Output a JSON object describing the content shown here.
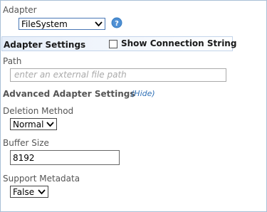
{
  "adapter": {
    "label": "Adapter",
    "selected": "FileSystem",
    "help_icon": "question-circle-icon"
  },
  "adapter_settings": {
    "title": "Adapter Settings",
    "show_connection_string_label": "Show Connection String",
    "show_connection_string_checked": false
  },
  "path": {
    "label": "Path",
    "placeholder": "enter an external file path",
    "value": ""
  },
  "advanced": {
    "title": "Advanced Adapter Settings",
    "hide_link": "(Hide)"
  },
  "deletion_method": {
    "label": "Deletion Method",
    "selected": "Normal"
  },
  "buffer_size": {
    "label": "Buffer Size",
    "value": "8192"
  },
  "support_metadata": {
    "label": "Support Metadata",
    "selected": "False"
  },
  "colors": {
    "border": "#a9bfd6",
    "link": "#2e6fb5",
    "help_icon": "#3b7fc4"
  }
}
